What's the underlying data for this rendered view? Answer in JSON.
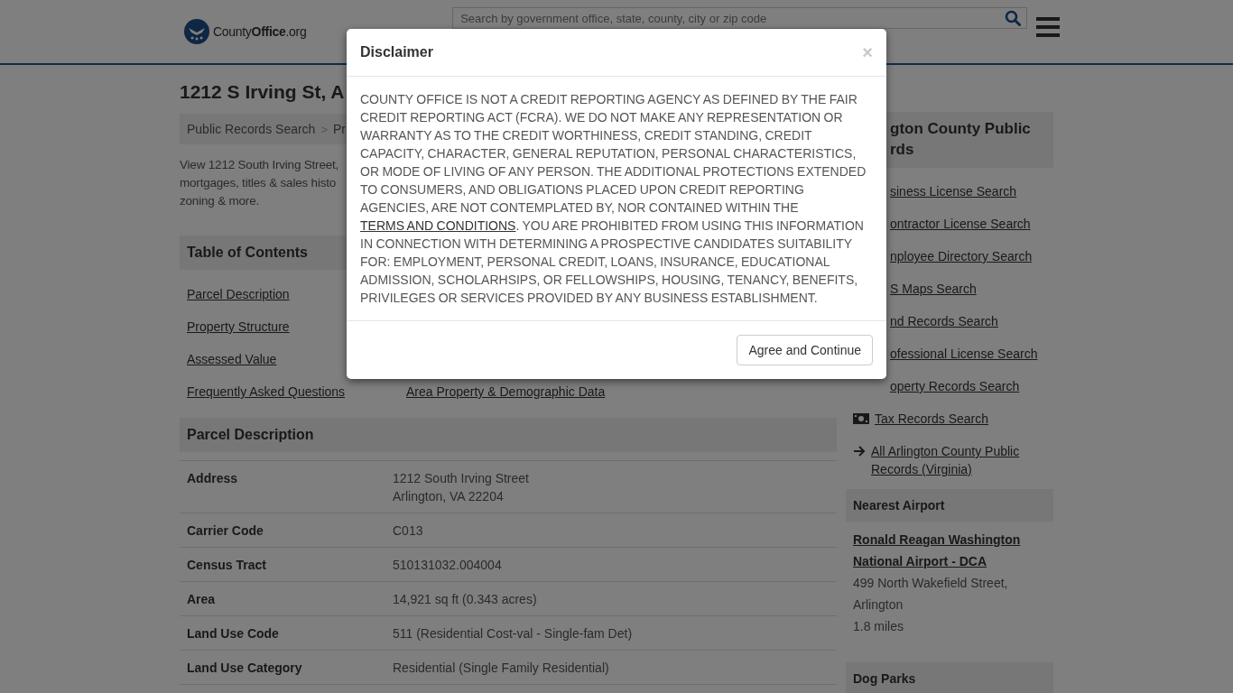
{
  "header": {
    "logo": "County**Office**.org",
    "search": {
      "placeholder": "Search by government office, state, county, city or zip code"
    }
  },
  "title": "1212 S Irving St, A",
  "breadcrumb": [
    {
      "label": "Public Records Search"
    },
    {
      "label": "Pr"
    }
  ],
  "breadcrumb_separator": ">",
  "description_lines": [
    "View 1212 South Irving Street,",
    "mortgages, titles & sales histo",
    "zoning & more."
  ],
  "toc": {
    "title": "Table of Contents",
    "rows": [
      {
        "left": "Parcel Description"
      },
      {
        "left": "Property Structure"
      },
      {
        "left": "Assessed Value"
      },
      {
        "left": "Frequently Asked Questions",
        "right": "Area Property & Demographic Data"
      }
    ]
  },
  "parcel": {
    "title": "Parcel Description",
    "rows": [
      {
        "label": "Address",
        "value": [
          "1212 South Irving Street",
          "Arlington, VA 22204"
        ]
      },
      {
        "label": "Carrier Code",
        "value": [
          "C013"
        ]
      },
      {
        "label": "Census Tract",
        "value": [
          "510131032.004004"
        ]
      },
      {
        "label": "Area",
        "value": [
          "14,921 sq ft (0.343 acres)"
        ]
      },
      {
        "label": "Land Use Code",
        "value": [
          "511 (Residential Cost-val - Single-fam Det)"
        ]
      },
      {
        "label": "Land Use Category",
        "value": [
          "Residential (Single Family Residential)"
        ]
      }
    ]
  },
  "sidebar": {
    "title_lines": [
      "gton County Public",
      "rds"
    ],
    "links": [
      {
        "label": "siness License Search"
      },
      {
        "label": "ontractor License Search"
      },
      {
        "label": "nployee Directory Search"
      },
      {
        "label": "S Maps Search"
      },
      {
        "label": "nd Records Search"
      },
      {
        "label": "ofessional License Search"
      },
      {
        "label": "operty Records Search"
      },
      {
        "label": "Tax Records Search",
        "kind": "tax"
      },
      {
        "label": "All Arlington County Public Records (Virginia)",
        "kind": "all"
      }
    ],
    "airport": {
      "title": "Nearest Airport",
      "name": "Ronald Reagan Washington National Airport - DCA",
      "address": "499 North Wakefield Street, Arlington",
      "distance": "1.8 miles"
    },
    "dog_parks": {
      "title": "Dog Parks"
    }
  },
  "modal": {
    "title": "Disclaimer",
    "close": "×",
    "text_before": "COUNTY OFFICE IS NOT A CREDIT REPORTING AGENCY AS DEFINED BY THE FAIR CREDIT REPORTING ACT (FCRA). WE DO NOT MAKE ANY REPRESENTATION OR WARRANTY AS TO THE CREDIT WORTHINESS, CREDIT STANDING, CREDIT CAPACITY, CHARACTER, GENERAL REPUTATION, PERSONAL CHARACTERISTICS, OR MODE OF LIVING OF ANY PERSON. THE ADDITIONAL PROTECTIONS EXTENDED TO CONSUMERS, AND OBLIGATIONS PLACED UPON CREDIT REPORTING AGENCIES, ARE NOT CONTEMPLATED BY, NOR CONTAINED WITHIN THE",
    "link": "TERMS AND CONDITIONS",
    "text_after": ". YOU ARE PROHIBITED FROM USING THIS INFORMATION IN CONNECTION WITH DETERMINING A PROSPECTIVE CANDIDATES SUITABILITY FOR: EMPLOYMENT, PERSONAL CREDIT, LOANS, INSURANCE, EDUCATIONAL ADMISSION, SCHOLARHSIPS, OR FELLOWSHIPS, HOUSING, TENANCY, BENEFITS, PRIVILEGES OR SERVICES PROVIDED BY ANY BUSINESS ESTABLISHMENT.",
    "button": "Agree and Continue"
  }
}
